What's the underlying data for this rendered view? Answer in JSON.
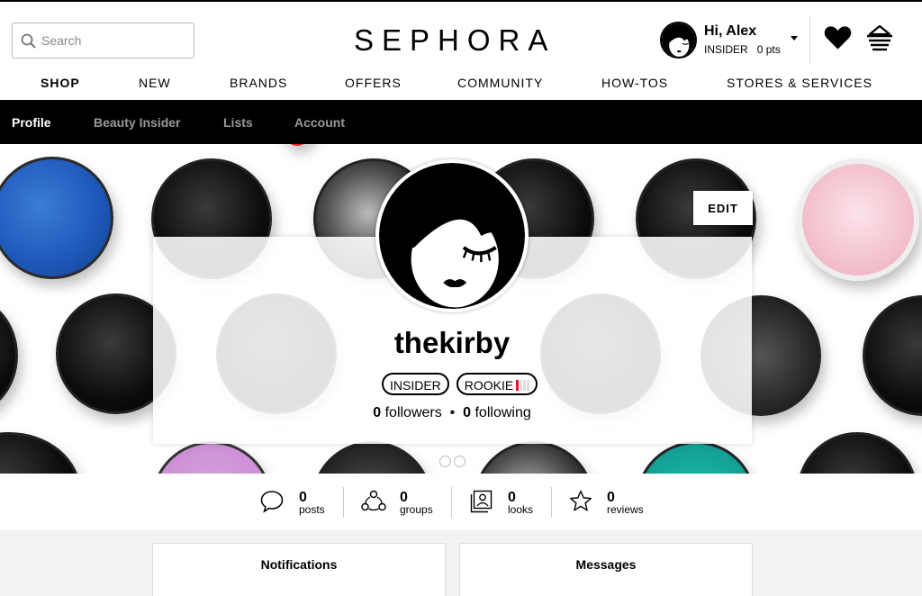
{
  "header": {
    "search_placeholder": "Search",
    "logo": "SEPHORA",
    "greeting": "Hi, Alex",
    "tier": "INSIDER",
    "points": "0 pts"
  },
  "main_nav": [
    "SHOP",
    "NEW",
    "BRANDS",
    "OFFERS",
    "COMMUNITY",
    "HOW-TOS",
    "STORES & SERVICES"
  ],
  "sub_nav": {
    "active": "Profile",
    "items": [
      "Profile",
      "Beauty Insider",
      "Lists",
      "Account"
    ]
  },
  "profile": {
    "edit_label": "EDIT",
    "username": "thekirby",
    "badges": [
      "INSIDER",
      "ROOKIE"
    ],
    "rookie_level": 1,
    "rookie_level_max": 4,
    "followers_count": "0",
    "followers_label": "followers",
    "separator": "•",
    "following_count": "0",
    "following_label": "following",
    "carousel_pages": 2
  },
  "stats": [
    {
      "icon": "speech-bubble-icon",
      "count": "0",
      "label": "posts"
    },
    {
      "icon": "groups-icon",
      "count": "0",
      "label": "groups"
    },
    {
      "icon": "looks-icon",
      "count": "0",
      "label": "looks"
    },
    {
      "icon": "star-icon",
      "count": "0",
      "label": "reviews"
    }
  ],
  "tabs": {
    "notifications": "Notifications",
    "messages": "Messages"
  },
  "colors": {
    "accent_red": "#e0162b",
    "subnav_bg": "#000000"
  }
}
